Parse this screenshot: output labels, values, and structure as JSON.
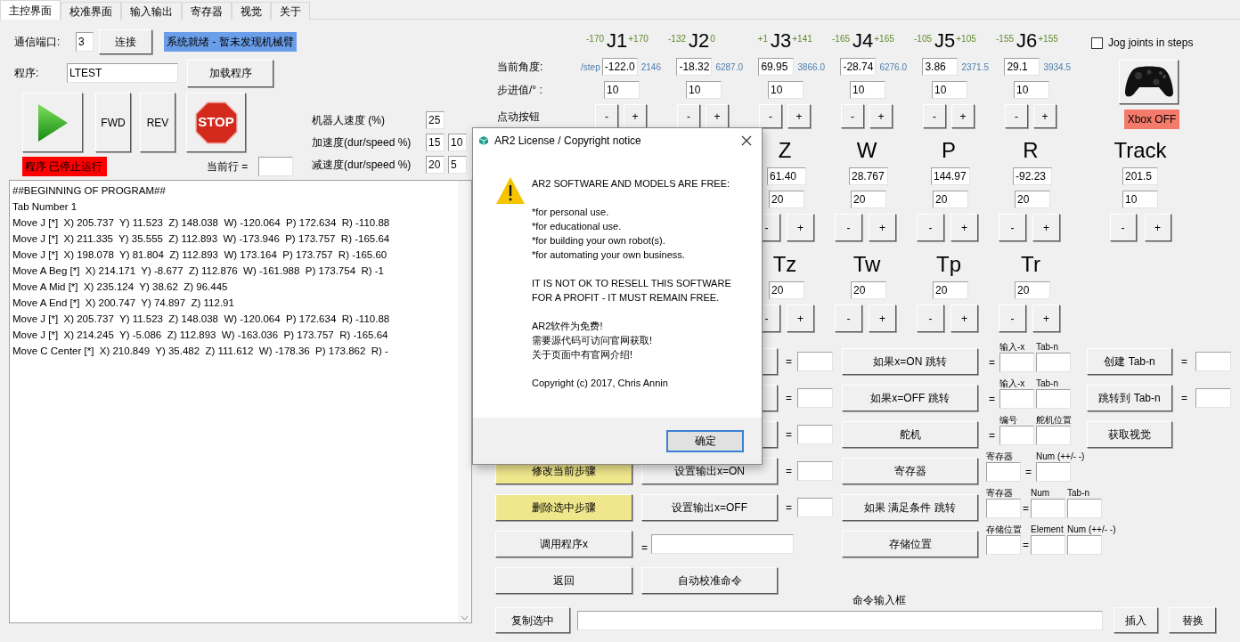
{
  "tabs": [
    {
      "label": "主控界面",
      "selected": true
    },
    {
      "label": "校准界面",
      "selected": false
    },
    {
      "label": "输入输出",
      "selected": false
    },
    {
      "label": "寄存器",
      "selected": false
    },
    {
      "label": "视觉",
      "selected": false
    },
    {
      "label": "关于",
      "selected": false
    }
  ],
  "connection": {
    "port_label": "通信端口:",
    "port": "3",
    "connect_button": "连接",
    "status": "系统就绪 - 暂未发现机械臂"
  },
  "program": {
    "label": "程序:",
    "name": "LTEST",
    "load_button": "加载程序"
  },
  "run_controls": {
    "forward": "FWD",
    "reverse": "REV",
    "stop": "STOP",
    "status": "程序 已停止运行",
    "current_line_label": "当前行 ="
  },
  "speed": [
    {
      "label": "机器人速度  (%)",
      "values": [
        "25"
      ]
    },
    {
      "label": "加速度(dur/speed %)",
      "values": [
        "15",
        "10"
      ]
    },
    {
      "label": "减速度(dur/speed %)",
      "values": [
        "20",
        "5"
      ]
    }
  ],
  "program_lines": [
    "##BEGINNING OF PROGRAM##",
    "Tab Number 1",
    "Move J [*]  X) 205.737  Y) 11.523  Z) 148.038  W) -120.064  P) 172.634  R) -110.88",
    "Move J [*]  X) 211.335  Y) 35.555  Z) 112.893  W) -173.946  P) 173.757  R) -165.64",
    "Move J [*]  X) 198.078  Y) 81.804  Z) 112.893  W) 173.164  P) 173.757  R) -165.60",
    "Move A Beg [*]  X) 214.171  Y) -8.677  Z) 112.876  W) -161.988  P) 173.754  R) -1",
    "Move A Mid [*]  X) 235.124  Y) 38.62  Z) 96.445",
    "Move A End [*]  X) 200.747  Y) 74.897  Z) 112.91",
    "Move J [*]  X) 205.737  Y) 11.523  Z) 148.038  W) -120.064  P) 172.634  R) -110.88",
    "Move J [*]  X) 214.245  Y) -5.086  Z) 112.893  W) -163.036  P) 173.757  R) -165.64",
    "Move C Center [*]  X) 210.849  Y) 35.482  Z) 111.612  W) -178.36  P) 173.862  R) -"
  ],
  "joints": {
    "row_labels": [
      "当前角度:",
      "步进值/° :",
      "点动按钮"
    ],
    "step_unit": "/step",
    "items": [
      {
        "name": "J1",
        "min": "-170",
        "max": "+170",
        "angle": "-122.0",
        "steps": "2146",
        "step_value": "10",
        "jog": [
          "-",
          "+"
        ]
      },
      {
        "name": "J2",
        "min": "-132",
        "max": "0",
        "angle": "-18.32",
        "steps": "6287.0",
        "step_value": "10",
        "jog": [
          "-",
          "+"
        ]
      },
      {
        "name": "J3",
        "min": "+1",
        "max": "+141",
        "angle": "69.95",
        "steps": "3866.0",
        "step_value": "10",
        "jog": [
          "-",
          "+"
        ]
      },
      {
        "name": "J4",
        "min": "-165",
        "max": "+165",
        "angle": "-28.74",
        "steps": "6276.0",
        "step_value": "10",
        "jog": [
          "-",
          "+"
        ]
      },
      {
        "name": "J5",
        "min": "-105",
        "max": "+105",
        "angle": "3.86",
        "steps": "2371.5",
        "step_value": "10",
        "jog": [
          "-",
          "+"
        ]
      },
      {
        "name": "J6",
        "min": "-155",
        "max": "+155",
        "angle": "29.1",
        "steps": "3934.5",
        "step_value": "10",
        "jog": [
          "-",
          "+"
        ]
      }
    ]
  },
  "jog_in_steps": {
    "label": "Jog joints in steps",
    "checked": false
  },
  "xbox": {
    "status": "Xbox OFF"
  },
  "cartesian": [
    {
      "name": "Z",
      "value": "61.40",
      "step": "20",
      "jog": [
        "-",
        "+"
      ]
    },
    {
      "name": "W",
      "value": "28.767",
      "step": "20",
      "jog": [
        "-",
        "+"
      ]
    },
    {
      "name": "P",
      "value": "144.97",
      "step": "20",
      "jog": [
        "-",
        "+"
      ]
    },
    {
      "name": "R",
      "value": "-92.23",
      "step": "20",
      "jog": [
        "-",
        "+"
      ]
    }
  ],
  "track": {
    "name": "Track",
    "value": "201.5",
    "step": "10",
    "jog": [
      "-",
      "+"
    ]
  },
  "tool": [
    {
      "name": "Tz",
      "step": "20",
      "jog": [
        "-",
        "+"
      ]
    },
    {
      "name": "Tw",
      "step": "20",
      "jog": [
        "-",
        "+"
      ]
    },
    {
      "name": "Tp",
      "step": "20",
      "jog": [
        "-",
        "+"
      ]
    },
    {
      "name": "Tr",
      "step": "20",
      "jog": [
        "-",
        "+"
      ]
    }
  ],
  "command_rows": [
    {
      "output": {
        "kind": "button",
        "eq": "="
      },
      "branch": "如果x=ON 跳转",
      "params": [
        {
          "kind": "eq",
          "text": "="
        },
        {
          "kind": "field",
          "label": "输入-x"
        },
        {
          "kind": "field",
          "label": "Tab-n"
        }
      ],
      "tab": {
        "label": "创建 Tab-n",
        "eq": "="
      }
    },
    {
      "output": {
        "kind": "button",
        "eq": "="
      },
      "branch": "如果x=OFF 跳转",
      "params": [
        {
          "kind": "eq",
          "text": "="
        },
        {
          "kind": "field",
          "label": "输入-x"
        },
        {
          "kind": "field",
          "label": "Tab-n"
        }
      ],
      "tab": {
        "label": "跳转到 Tab-n",
        "eq": "="
      }
    },
    {
      "output": {
        "kind": "button",
        "eq": "="
      },
      "branch": "舵机",
      "params": [
        {
          "kind": "eq",
          "text": "="
        },
        {
          "kind": "field",
          "label": "编号"
        },
        {
          "kind": "field",
          "label": "舵机位置"
        }
      ],
      "tab": {
        "label": "获取视觉"
      }
    },
    {
      "action": {
        "label": "修改当前步骤",
        "highlighted": true
      },
      "output": {
        "kind": "button",
        "label": "设置输出x=ON",
        "eq": "="
      },
      "branch": "寄存器",
      "params": [
        {
          "kind": "field",
          "label": "寄存器"
        },
        {
          "kind": "eq",
          "text": "="
        },
        {
          "kind": "field",
          "label": "Num (++/- -)"
        }
      ]
    },
    {
      "action": {
        "label": "删除选中步骤",
        "highlighted": true
      },
      "output": {
        "kind": "button",
        "label": "设置输出x=OFF",
        "eq": "="
      },
      "branch": "如果 满足条件 跳转",
      "params": [
        {
          "kind": "field",
          "label": "寄存器"
        },
        {
          "kind": "eq",
          "text": "="
        },
        {
          "kind": "field",
          "label": "Num"
        },
        {
          "kind": "field",
          "label": "Tab-n"
        }
      ]
    },
    {
      "action": {
        "label": "调用程序x",
        "highlighted": false
      },
      "output": {
        "kind": "call",
        "eq": "="
      },
      "branch": "存储位置",
      "params": [
        {
          "kind": "field",
          "label": "存储位置"
        },
        {
          "kind": "eq",
          "text": "="
        },
        {
          "kind": "field",
          "label": "Element"
        },
        {
          "kind": "field",
          "label": "Num (++/- -)"
        }
      ]
    },
    {
      "action": {
        "label": "返回",
        "highlighted": false
      },
      "output": {
        "kind": "button",
        "label": "自动校准命令"
      }
    }
  ],
  "command_entry": {
    "label": "命令输入框",
    "copy_button": "复制选中",
    "insert_button": "插入",
    "replace_button": "替换"
  },
  "dialog": {
    "title": "AR2 License / Copyright notice",
    "paragraphs": [
      "AR2 SOFTWARE AND MODELS ARE FREE:",
      "*for personal use.\n*for educational use.\n*for building your own robot(s).\n*for automating your own business.",
      "IT IS NOT OK TO RESELL THIS SOFTWARE\nFOR A PROFIT - IT MUST REMAIN FREE.",
      "AR2软件为免费!\n需要源代码可访问官网获取!\n关于页面中有官网介绍!",
      "Copyright (c) 2017, Chris Annin"
    ],
    "ok_button": "确定"
  }
}
